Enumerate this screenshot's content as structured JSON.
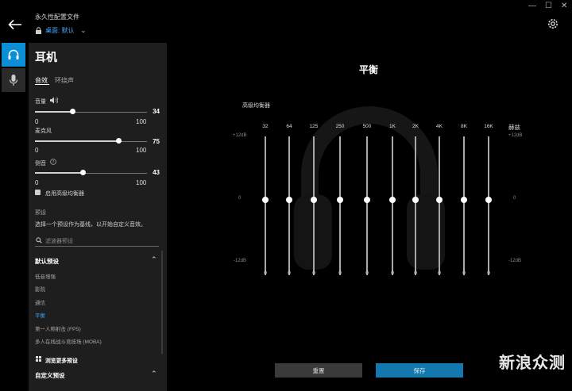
{
  "profile": {
    "title": "永久性配置文件",
    "current": "桌面: 默认"
  },
  "panel": {
    "title": "耳机",
    "tabs": [
      "音效",
      "环绕声"
    ],
    "sliders": [
      {
        "label": "音量",
        "min": "0",
        "max": "100",
        "value": "34",
        "fraction": 0.34
      },
      {
        "label": "麦克风",
        "min": "0",
        "max": "100",
        "value": "75",
        "fraction": 0.75
      },
      {
        "label": "侧音",
        "min": "0",
        "max": "100",
        "value": "43",
        "fraction": 0.43
      }
    ],
    "eq_checkbox": "启用高级均衡器",
    "presets_label": "预设",
    "presets_hint": "选择一个预设作为基线，以开始自定义音效。",
    "filter_placeholder": "滤波器预设",
    "default_section": "默认预设",
    "presets": [
      "低音增强",
      "影院",
      "通信",
      "平衡",
      "第一人称射击 (FPS)",
      "多人在线战斗竞技场 (MOBA)"
    ],
    "active_preset": "平衡",
    "more_presets": "浏览更多预设",
    "custom_section": "自定义预设"
  },
  "main": {
    "title": "平衡",
    "eq_title": "高级均衡器",
    "unit": "赫兹",
    "db_top": "+12dB",
    "db_mid": "0",
    "db_bottom": "-12dB",
    "bands": [
      {
        "freq": "32",
        "value": "0"
      },
      {
        "freq": "64",
        "value": "0"
      },
      {
        "freq": "125",
        "value": "0"
      },
      {
        "freq": "250",
        "value": "0"
      },
      {
        "freq": "500",
        "value": "0"
      },
      {
        "freq": "1K",
        "value": "0"
      },
      {
        "freq": "2K",
        "value": "0"
      },
      {
        "freq": "4K",
        "value": "0"
      },
      {
        "freq": "8K",
        "value": "0"
      },
      {
        "freq": "16K",
        "value": "0"
      }
    ],
    "reset_label": "重置",
    "save_label": "保存"
  },
  "watermark": "新浪众测",
  "window_controls": [
    "—",
    "☐",
    "✕"
  ],
  "colors": {
    "accent": "#0a8fd6",
    "active_preset": "#2fa6ff",
    "panel_bg": "#1e1e1e",
    "save_button": "#1378ae"
  },
  "icons": [
    "back-arrow-icon",
    "lock-icon",
    "chevron-down-icon",
    "gear-icon",
    "headset-icon",
    "microphone-icon",
    "volume-icon",
    "help-icon",
    "search-icon",
    "chevron-up-icon",
    "grid-icon"
  ]
}
